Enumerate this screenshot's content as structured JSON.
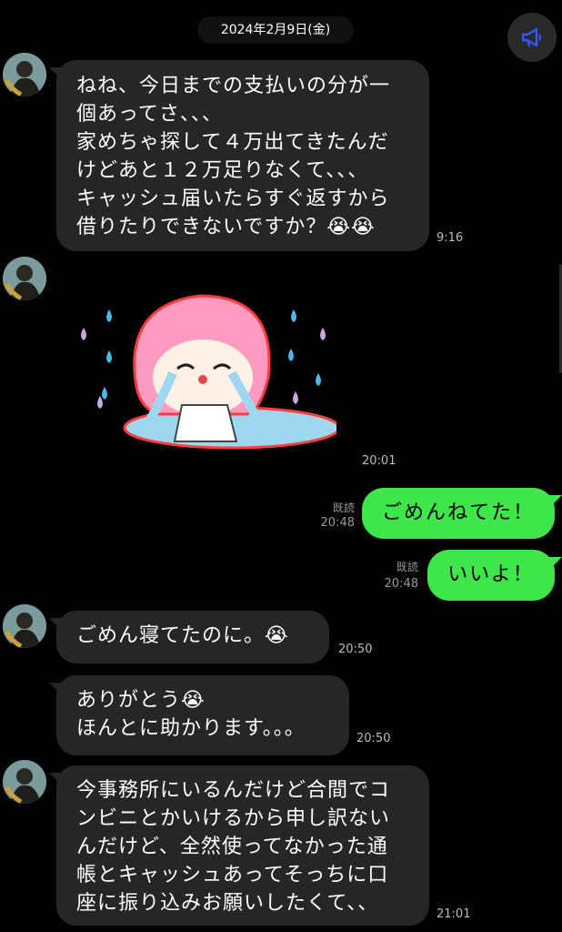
{
  "header": {
    "date": "2024年2月9日(金)",
    "announce_icon": "megaphone-icon",
    "accent": "#2f5bff"
  },
  "messages": [
    {
      "side": "in",
      "text": "ねね、今日までの支払いの分が一\n個あってさ、、、\n家めちゃ探して４万出てきたんだ\nけどあと１２万足りなくて、、、\nキャッシュ届いたらすぐ返すから\n借りたりできないですか？😭😭",
      "time": "9:16"
    },
    {
      "side": "in",
      "sticker": "crying-girl-sticker",
      "time": "20:01"
    },
    {
      "side": "out",
      "text": "ごめんねてた！",
      "read": "既読",
      "time": "20:48"
    },
    {
      "side": "out",
      "text": "いいよ！",
      "read": "既読",
      "time": "20:48"
    },
    {
      "side": "in",
      "text": "ごめん寝てたのに。😭",
      "time": "20:50"
    },
    {
      "side": "in",
      "text": "ありがとう😭\nほんとに助かります。。。",
      "time": "20:50"
    },
    {
      "side": "in",
      "text": "今事務所にいるんだけど合間でコ\nンビニとかいけるから申し訳ない\nんだけど、全然使ってなかった通\n帳とキャッシュあってそっちに口\n座に振り込みお願いしたくて、、",
      "time": "21:01"
    }
  ],
  "colors": {
    "incoming_bubble": "#262626",
    "outgoing_bubble": "#3ee64c",
    "background": "#000000"
  }
}
